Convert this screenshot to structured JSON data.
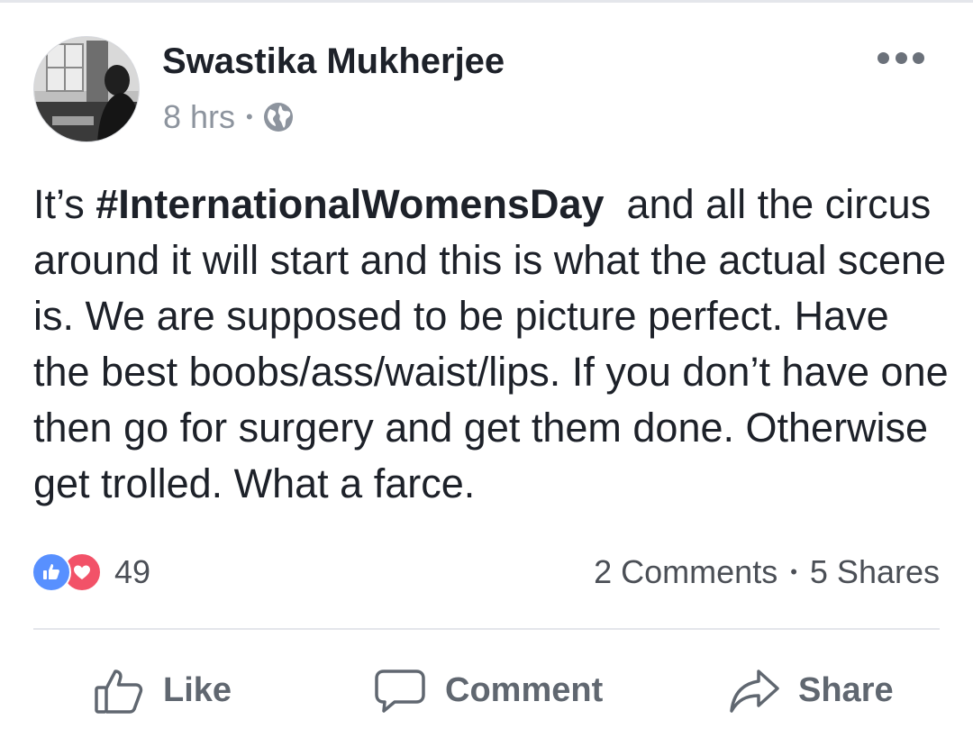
{
  "post": {
    "author": "Swastika Mukherjee",
    "timestamp": "8 hrs",
    "meta_separator": "•",
    "audience_icon": "globe-icon",
    "more_icon": "more-options-icon",
    "text_before_hashtag": "It’s ",
    "hashtag": "#InternationalWomensDay",
    "text_after_hashtag": "  and all the circus around it will start and this is what the actual scene is. We are supposed to be picture perfect. Have the best boobs/ass/waist/lips. If you don’t have one then go for surgery and get them done. Otherwise get trolled. What a farce."
  },
  "engagement": {
    "reaction_icons": [
      "like-reaction-icon",
      "love-reaction-icon"
    ],
    "reaction_count": "49",
    "comments": "2 Comments",
    "separator": "•",
    "shares": "5 Shares"
  },
  "actions": {
    "like_label": "Like",
    "comment_label": "Comment",
    "share_label": "Share"
  },
  "colors": {
    "text": "#1d2129",
    "secondary_text": "#8d949e",
    "action_text": "#606770",
    "like_blue": "#5890ff",
    "love_red": "#f25268",
    "divider": "#e4e6eb"
  }
}
